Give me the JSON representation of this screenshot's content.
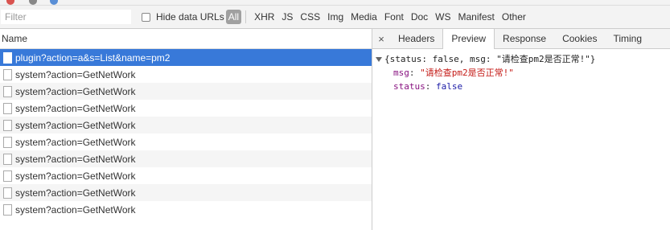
{
  "filter": {
    "placeholder": "Filter"
  },
  "hide_data_urls_label": "Hide data URLs",
  "type_filters": [
    "All",
    "XHR",
    "JS",
    "CSS",
    "Img",
    "Media",
    "Font",
    "Doc",
    "WS",
    "Manifest",
    "Other"
  ],
  "requests": {
    "header": "Name",
    "items": [
      "plugin?action=a&s=List&name=pm2",
      "system?action=GetNetWork",
      "system?action=GetNetWork",
      "system?action=GetNetWork",
      "system?action=GetNetWork",
      "system?action=GetNetWork",
      "system?action=GetNetWork",
      "system?action=GetNetWork",
      "system?action=GetNetWork",
      "system?action=GetNetWork"
    ]
  },
  "detail_tabs": {
    "close": "×",
    "items": [
      "Headers",
      "Preview",
      "Response",
      "Cookies",
      "Timing"
    ],
    "active": "Preview"
  },
  "preview": {
    "summary": "{status: false, msg: \"请检查pm2是否正常!\"}",
    "msg_key": "msg",
    "msg_value": "\"请检查pm2是否正常!\"",
    "status_key": "status",
    "status_value": "false"
  },
  "colors": {
    "selected_row": "#3879d9",
    "string": "#c41a16",
    "key": "#881280",
    "boolean": "#1a1aa6"
  }
}
